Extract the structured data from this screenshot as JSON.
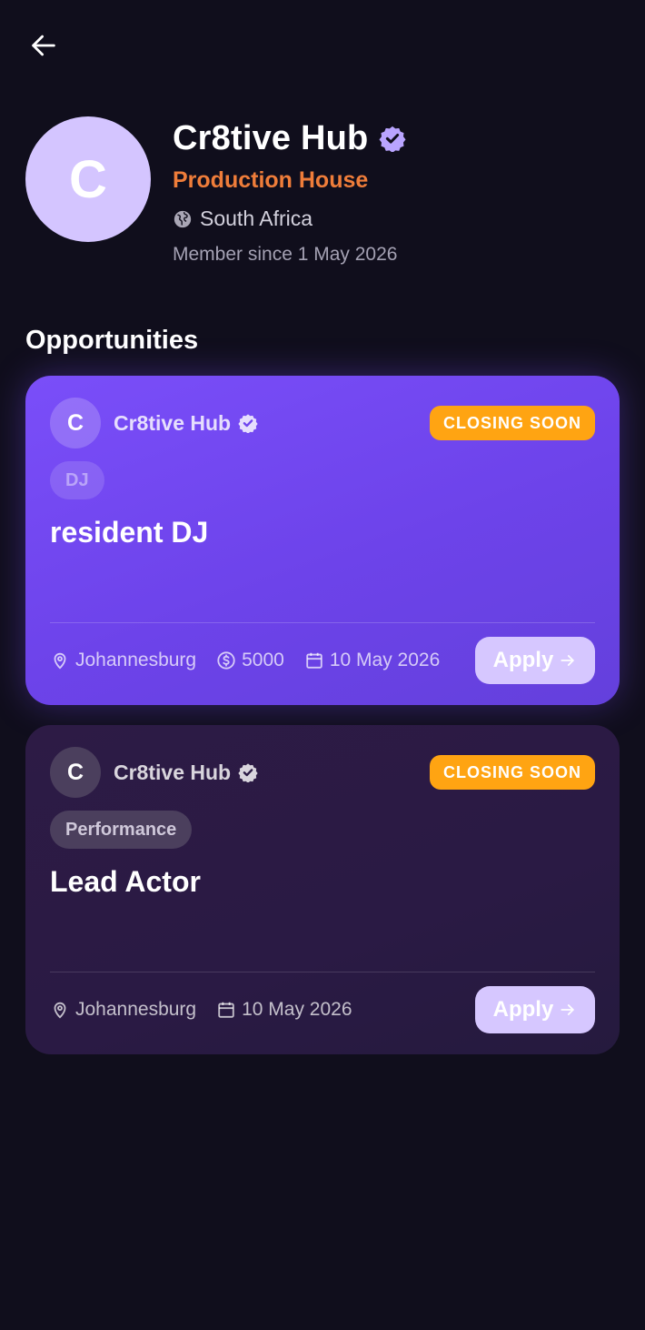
{
  "colors": {
    "background": "#100e1c",
    "accent": "#7a4ef9",
    "orange": "#ef7d3a",
    "badge": "#ffa412",
    "avatar": "#d4c5ff",
    "button": "#d6c7ff"
  },
  "profile": {
    "initial": "C",
    "name": "Cr8tive Hub",
    "verified_icon": "verified-badge-icon",
    "type": "Production House",
    "location": "South Africa",
    "member_since": "Member since 1 May 2026"
  },
  "section": {
    "title": "Opportunities"
  },
  "opportunities": [
    {
      "initial": "C",
      "company": "Cr8tive Hub",
      "badge": "CLOSING SOON",
      "tag": "DJ",
      "title": "resident DJ",
      "location": "Johannesburg",
      "pay": "5000",
      "date": "10 May 2026",
      "apply_label": "Apply"
    },
    {
      "initial": "C",
      "company": "Cr8tive Hub",
      "badge": "CLOSING SOON",
      "tag": "Performance",
      "title": "Lead Actor",
      "location": "Johannesburg",
      "date": "10 May 2026",
      "apply_label": "Apply"
    }
  ]
}
